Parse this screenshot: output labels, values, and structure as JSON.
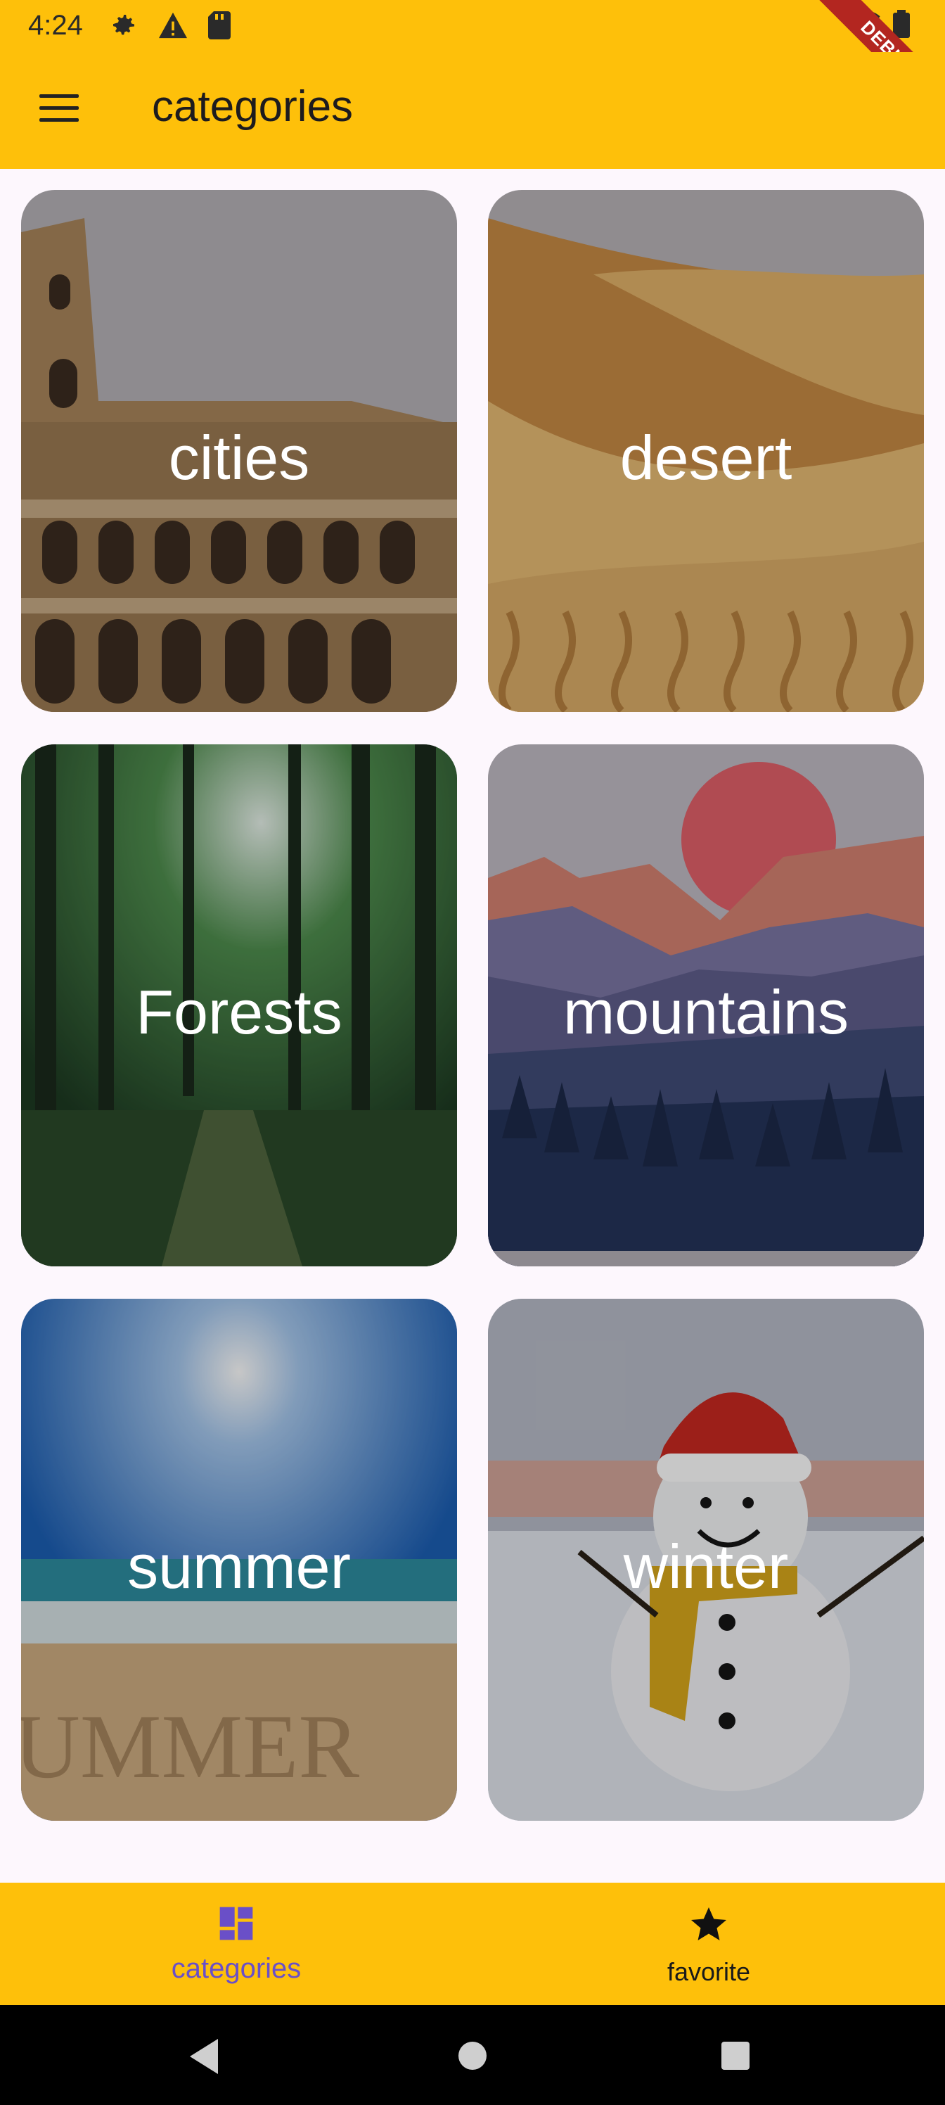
{
  "status_bar": {
    "time": "4:24",
    "debug_banner": "DEBUG"
  },
  "app_bar": {
    "title": "categories",
    "menu_icon": "hamburger-menu-icon"
  },
  "categories": [
    {
      "label": "cities",
      "image": "colosseum-photo"
    },
    {
      "label": "desert",
      "image": "desert-dunes-illustration"
    },
    {
      "label": "Forests",
      "image": "forest-path-photo"
    },
    {
      "label": "mountains",
      "image": "mountain-sunset-illustration"
    },
    {
      "label": "summer",
      "image": "beach-summer-photo"
    },
    {
      "label": "winter",
      "image": "snowman-photo"
    }
  ],
  "bottom_nav": {
    "items": [
      {
        "label": "categories",
        "icon": "dashboard-icon",
        "selected": true
      },
      {
        "label": "favorite",
        "icon": "star-icon",
        "selected": false
      }
    ],
    "selected_color": "#6a4fc8",
    "unselected_color": "#1a1a1a"
  },
  "colors": {
    "primary": "#fec00a",
    "background": "#fdf7fd"
  }
}
